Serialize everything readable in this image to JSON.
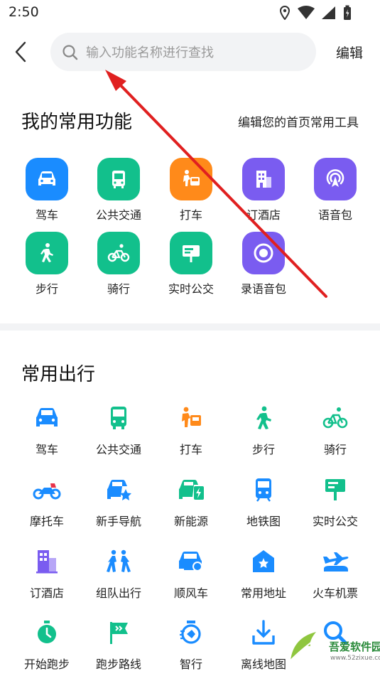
{
  "status_bar": {
    "time": "2:50"
  },
  "top_bar": {
    "search_placeholder": "输入功能名称进行查找",
    "edit_label": "编辑"
  },
  "my_functions": {
    "title": "我的常用功能",
    "subtitle": "编辑您的首页常用工具",
    "items": [
      {
        "label": "驾车",
        "icon": "car-icon",
        "color": "#1a8cff"
      },
      {
        "label": "公共交通",
        "icon": "bus-icon",
        "color": "#12c08c"
      },
      {
        "label": "打车",
        "icon": "taxi-icon",
        "color": "#ff8a1a"
      },
      {
        "label": "订酒店",
        "icon": "hotel-icon",
        "color": "#7a5cf0"
      },
      {
        "label": "语音包",
        "icon": "voice-pack-icon",
        "color": "#7a5cf0"
      },
      {
        "label": "步行",
        "icon": "walk-icon",
        "color": "#12c08c"
      },
      {
        "label": "骑行",
        "icon": "bike-icon",
        "color": "#12c08c"
      },
      {
        "label": "实时公交",
        "icon": "realtime-bus-icon",
        "color": "#12c08c"
      },
      {
        "label": "录语音包",
        "icon": "record-voice-icon",
        "color": "#7a5cf0"
      }
    ]
  },
  "common_travel": {
    "title": "常用出行",
    "items": [
      {
        "label": "驾车",
        "icon": "car-icon",
        "color": "#1a8cff"
      },
      {
        "label": "公共交通",
        "icon": "bus-icon",
        "color": "#12c08c"
      },
      {
        "label": "打车",
        "icon": "taxi-icon",
        "color": "#ff8a1a"
      },
      {
        "label": "步行",
        "icon": "walk-icon",
        "color": "#12c08c"
      },
      {
        "label": "骑行",
        "icon": "bike-icon",
        "color": "#12c08c"
      },
      {
        "label": "摩托车",
        "icon": "motorcycle-icon",
        "color": "#1a8cff"
      },
      {
        "label": "新手导航",
        "icon": "beginner-nav-icon",
        "color": "#1a8cff"
      },
      {
        "label": "新能源",
        "icon": "new-energy-icon",
        "color": "#12c08c"
      },
      {
        "label": "地铁图",
        "icon": "subway-icon",
        "color": "#1a8cff"
      },
      {
        "label": "实时公交",
        "icon": "realtime-bus-icon",
        "color": "#12c08c"
      },
      {
        "label": "订酒店",
        "icon": "hotel-icon",
        "color": "#7a5cf0"
      },
      {
        "label": "组队出行",
        "icon": "team-travel-icon",
        "color": "#1a8cff"
      },
      {
        "label": "顺风车",
        "icon": "carpool-icon",
        "color": "#1a8cff"
      },
      {
        "label": "常用地址",
        "icon": "home-address-icon",
        "color": "#1a8cff"
      },
      {
        "label": "火车机票",
        "icon": "train-plane-icon",
        "color": "#1a8cff"
      },
      {
        "label": "开始跑步",
        "icon": "stopwatch-icon",
        "color": "#12c08c"
      },
      {
        "label": "跑步路线",
        "icon": "run-route-flag-icon",
        "color": "#12c08c"
      },
      {
        "label": "智行",
        "icon": "smart-travel-icon",
        "color": "#1a8cff"
      },
      {
        "label": "离线地图",
        "icon": "download-icon",
        "color": "#1a8cff"
      },
      {
        "label": "",
        "icon": "search-icon",
        "color": "#1a8cff"
      }
    ]
  },
  "watermark": {
    "text": "吾爱软件园",
    "url": "www.52zixue.com"
  },
  "annotation": {
    "arrow_color": "#e02020"
  }
}
